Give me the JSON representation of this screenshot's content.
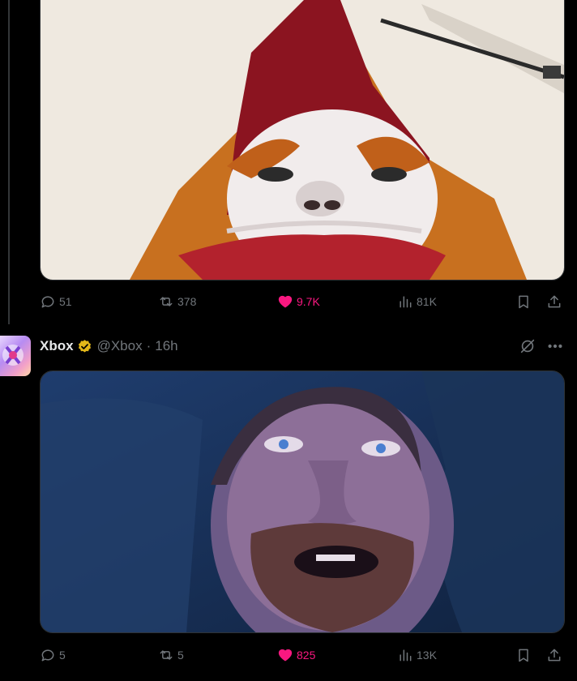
{
  "post1": {
    "media_desc_icon": "photo",
    "actions": {
      "reply_count": "51",
      "repost_count": "378",
      "like_count": "9.7K",
      "view_count": "81K"
    }
  },
  "post2": {
    "author_name": "Xbox",
    "author_handle": "@Xbox",
    "separator": "·",
    "time": "16h",
    "actions": {
      "reply_count": "5",
      "repost_count": "5",
      "like_count": "825",
      "view_count": "13K"
    }
  },
  "colors": {
    "like_active": "#f91880",
    "muted": "#71767b",
    "verified_gold": "#e2b719",
    "accent": "#1d9bf0"
  },
  "icons": [
    "reply-icon",
    "repost-icon",
    "heart-icon",
    "views-icon",
    "bookmark-icon",
    "share-icon",
    "verified-badge-icon",
    "grok-icon",
    "more-icon"
  ]
}
